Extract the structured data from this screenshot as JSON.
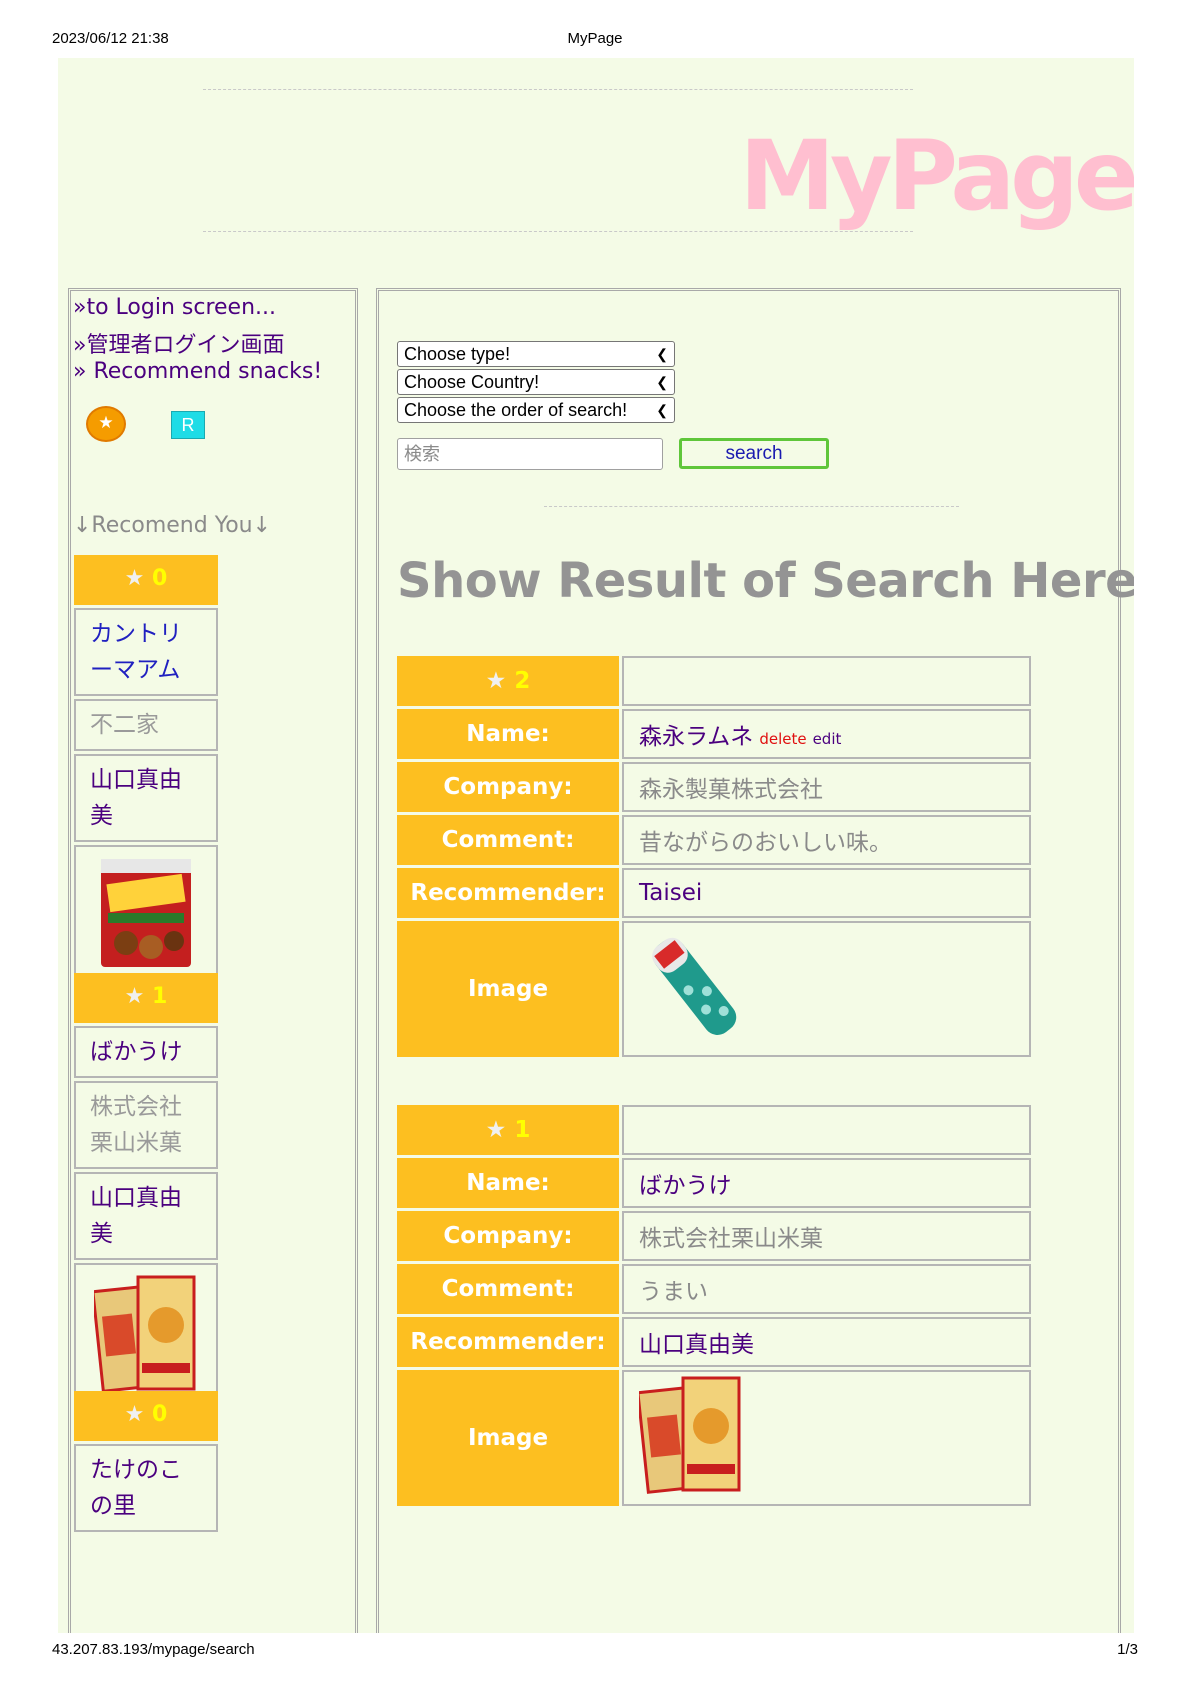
{
  "print": {
    "datetime": "2023/06/12 21:38",
    "title": "MyPage",
    "url": "43.207.83.193/mypage/search",
    "page": "1/3"
  },
  "header": {
    "logo": "MyPage"
  },
  "sidebar": {
    "links": [
      "»to Login screen...",
      "»管理者ログイン画面",
      "» Recommend snacks!"
    ],
    "star_button": "★",
    "r_button": "R",
    "recommend_title": "↓Recomend You↓",
    "cards": [
      {
        "star": "★",
        "count": "0",
        "name": "カントリーマアム",
        "company": "不二家",
        "recommender": "山口真由美",
        "image_icon": "country-ma-am-package"
      },
      {
        "star": "★",
        "count": "1",
        "name": "ばかうけ",
        "company": "株式会社栗山米菓",
        "recommender": "山口真由美",
        "image_icon": "bakauke-package"
      },
      {
        "star": "★",
        "count": "0",
        "name": "たけのこの里"
      }
    ]
  },
  "search": {
    "type_select": "Choose type!",
    "country_select": "Choose Country!",
    "order_select": "Choose the order of search!",
    "input_placeholder": "検索",
    "button_label": "search"
  },
  "result_title": "Show Result of Search Here",
  "labels": {
    "name": "Name:",
    "company": "Company:",
    "comment": "Comment:",
    "recommender": "Recommender:",
    "image": "Image",
    "delete": "delete",
    "edit": "edit"
  },
  "results": [
    {
      "star": "★",
      "count": "2",
      "name": "森永ラムネ",
      "company": "森永製菓株式会社",
      "comment": "昔ながらのおいしい味。",
      "recommender": "Taisei",
      "image_icon": "ramune-bottle"
    },
    {
      "star": "★",
      "count": "1",
      "name": "ばかうけ",
      "company": "株式会社栗山米菓",
      "comment": "うまい",
      "recommender": "山口真由美",
      "image_icon": "bakauke-package"
    }
  ],
  "colors": {
    "accent": "#fdbf20",
    "page_bg": "#f4fbe6",
    "logo": "#ffbfd0",
    "link": "#4b007f"
  }
}
